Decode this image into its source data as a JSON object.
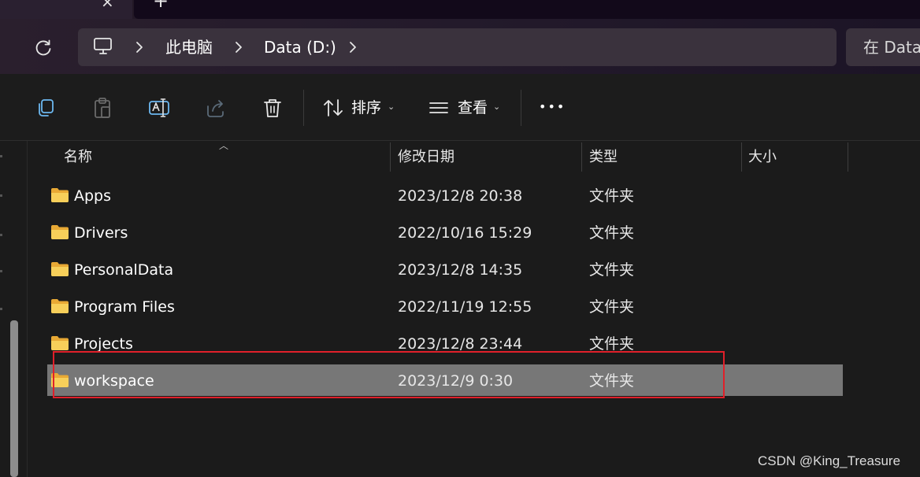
{
  "tabs": {
    "close_glyph": "×",
    "new_glyph": "+"
  },
  "address": {
    "icons": [
      "refresh-icon",
      "this-pc-icon",
      "chevron-right-icon"
    ],
    "crumbs": [
      "此电脑",
      "Data (D:)"
    ],
    "search_placeholder": "在 Data"
  },
  "toolbar": {
    "icons": [
      "copy-icon",
      "paste-icon",
      "rename-icon",
      "share-icon",
      "delete-icon",
      "sort-icon",
      "view-icon",
      "more-icon"
    ],
    "sort_label": "排序",
    "view_label": "查看",
    "caret": "⌄",
    "more_label": "•••"
  },
  "columns": {
    "name": "名称",
    "date": "修改日期",
    "type": "类型",
    "size": "大小",
    "sort_indicator": "︿"
  },
  "files": [
    {
      "name": "Apps",
      "date": "2023/12/8 20:38",
      "type": "文件夹",
      "size": "",
      "selected": false
    },
    {
      "name": "Drivers",
      "date": "2022/10/16 15:29",
      "type": "文件夹",
      "size": "",
      "selected": false
    },
    {
      "name": "PersonalData",
      "date": "2023/12/8 14:35",
      "type": "文件夹",
      "size": "",
      "selected": false
    },
    {
      "name": "Program Files",
      "date": "2022/11/19 12:55",
      "type": "文件夹",
      "size": "",
      "selected": false
    },
    {
      "name": "Projects",
      "date": "2023/12/8 23:44",
      "type": "文件夹",
      "size": "",
      "selected": false
    },
    {
      "name": "workspace",
      "date": "2023/12/9 0:30",
      "type": "文件夹",
      "size": "",
      "selected": true
    }
  ],
  "colors": {
    "highlight_box": "#e0202a",
    "selected_row": "#777777",
    "folder": "#f4c04a"
  },
  "watermark": "CSDN @King_Treasure"
}
